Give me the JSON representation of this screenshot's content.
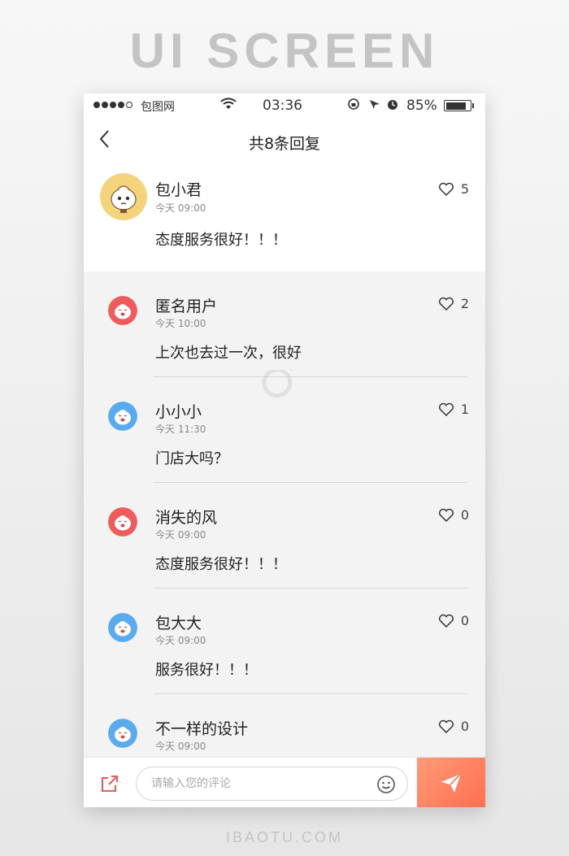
{
  "page": {
    "heading": "UI SCREEN",
    "footer_site": "IBAOTU.COM"
  },
  "status_bar": {
    "carrier": "包图网",
    "time": "03:36",
    "battery": "85%",
    "battery_level": 0.85
  },
  "nav": {
    "title": "共8条回复"
  },
  "main_comment": {
    "name": "包小君",
    "time": "今天 09:00",
    "text": "态度服务很好！！！",
    "likes": "5"
  },
  "replies": [
    {
      "name": "匿名用户",
      "time": "今天 10:00",
      "text": "上次也去过一次，很好",
      "likes": "2",
      "avatar_color": "#f05a5a"
    },
    {
      "name": "小小小",
      "time": "今天 11:30",
      "text": "门店大吗？",
      "likes": "1",
      "avatar_color": "#5aaaf0"
    },
    {
      "name": "消失的风",
      "time": "今天 09:00",
      "text": "态度服务很好！！！",
      "likes": "0",
      "avatar_color": "#f05a5a"
    },
    {
      "name": "包大大",
      "time": "今天 09:00",
      "text": "服务很好！！！",
      "likes": "0",
      "avatar_color": "#5aaaf0"
    },
    {
      "name": "不一样的设计",
      "time": "今天 09:00",
      "text": "",
      "likes": "0",
      "avatar_color": "#5aaaf0"
    }
  ],
  "watermark": {
    "text": "包图网"
  },
  "composer": {
    "placeholder": "请输入您的评论",
    "value": ""
  },
  "colors": {
    "accent": "#ff7a58",
    "main_avatar_bg": "#f5d37a"
  }
}
